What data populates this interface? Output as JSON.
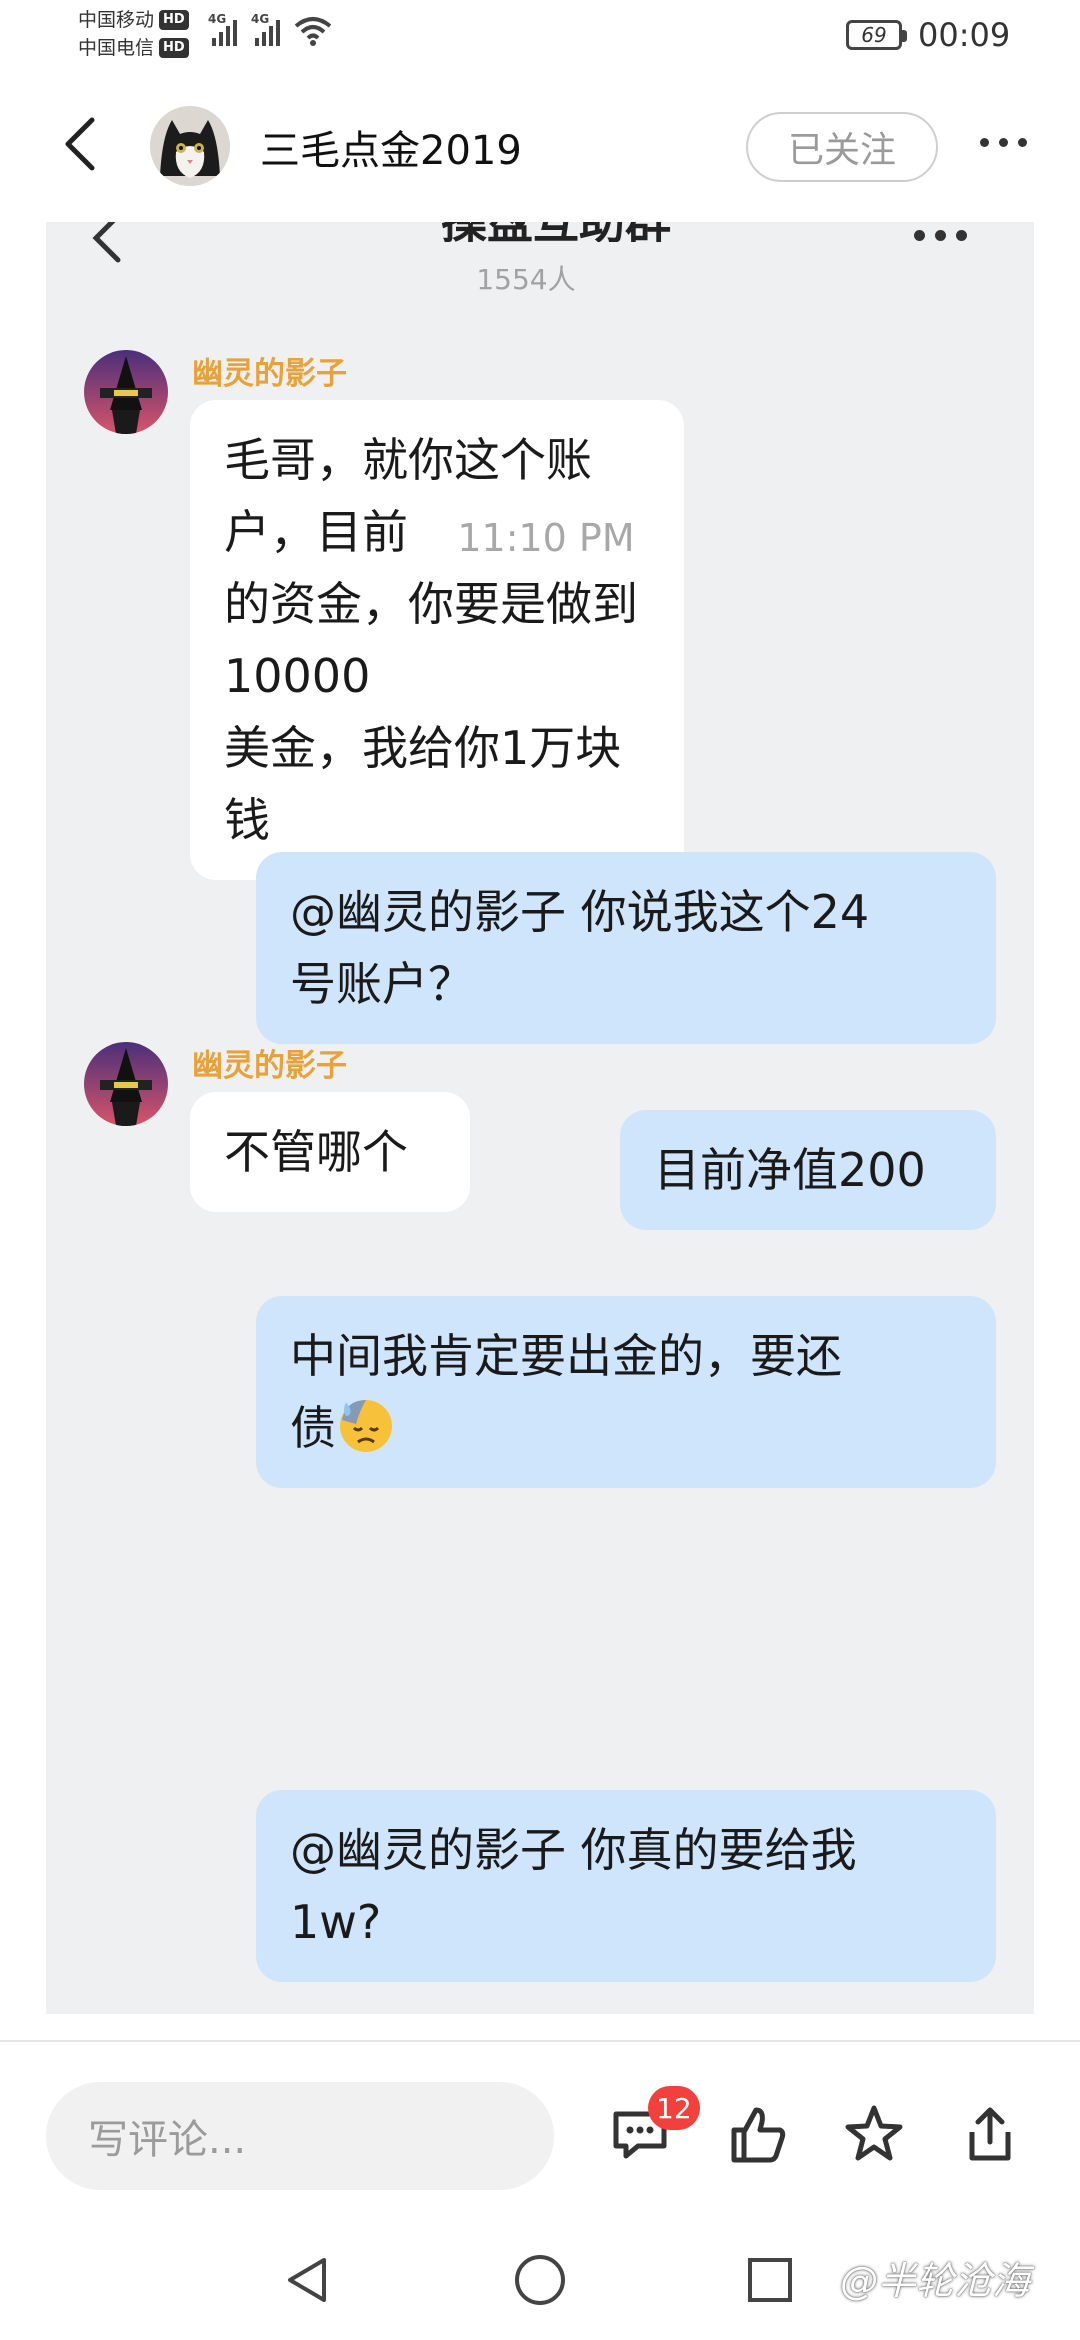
{
  "status_bar": {
    "carrier_1": "中国移动",
    "carrier_2": "中国电信",
    "hd_tag": "HD",
    "network_tag": "4G",
    "battery": "69",
    "time": "00:09"
  },
  "header": {
    "user_name": "三毛点金2019",
    "follow_label": "已关注"
  },
  "chat": {
    "group_title": "操盘互助群",
    "member_count": "1554人",
    "timestamp": "11:10 PM",
    "messages": [
      {
        "side": "in",
        "sender": "幽灵的影子",
        "lines": [
          "毛哥，就你这个账户，目前",
          "的资金，你要是做到10000",
          "美金，我给你1万块钱"
        ]
      },
      {
        "side": "out",
        "lines": [
          "@幽灵的影子 你说我这个24",
          "号账户？"
        ]
      },
      {
        "side": "out",
        "lines": [
          "目前净值200"
        ]
      },
      {
        "side": "out",
        "lines": [
          "中间我肯定要出金的，要还",
          "债"
        ],
        "emoji": "downcast-sweat-face"
      },
      {
        "side": "in",
        "sender": "幽灵的影子",
        "lines": [
          "不管哪个"
        ]
      },
      {
        "side": "out",
        "lines": [
          "@幽灵的影子 你真的要给我",
          "1w?"
        ]
      }
    ]
  },
  "bottom_bar": {
    "comment_placeholder": "写评论...",
    "comment_count": "12"
  },
  "watermark": "@半轮沧海",
  "colors": {
    "chat_background": "#eff0f2",
    "outgoing_bubble": "#cfe5fb",
    "incoming_bubble": "#ffffff",
    "sender_name": "#e8a23a",
    "badge": "#f2413c"
  }
}
